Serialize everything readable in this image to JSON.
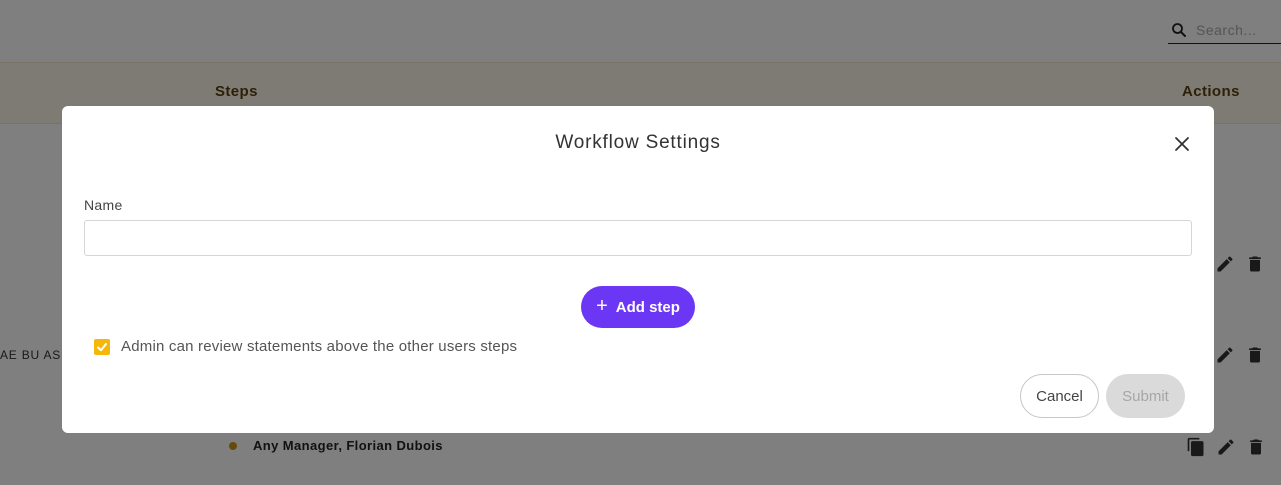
{
  "background": {
    "search": {
      "placeholder": "Search..."
    },
    "table": {
      "columns": {
        "steps": "Steps",
        "actions": "Actions"
      },
      "row_cell_left": "AE BU ASIA",
      "step_item": "Any Manager, Florian Dubois"
    }
  },
  "modal": {
    "title": "Workflow Settings",
    "name_label": "Name",
    "name_value": "",
    "add_step_label": "Add step",
    "checkbox": {
      "label": "Admin can review statements above the other users steps",
      "checked": true
    },
    "cancel_label": "Cancel",
    "submit_label": "Submit"
  },
  "colors": {
    "accent_purple": "#6c36f5",
    "checkbox_yellow": "#f5b80a",
    "step_dot": "#c8960e"
  }
}
